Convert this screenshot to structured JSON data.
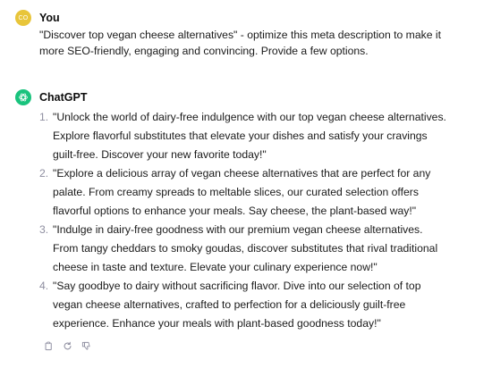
{
  "user_message": {
    "avatar_initials": "CO",
    "author": "You",
    "text": "\"Discover top vegan cheese alternatives\" - optimize this meta description to make it more SEO-friendly, engaging and convincing. Provide a few options."
  },
  "assistant_message": {
    "author": "ChatGPT",
    "avatar_icon": "openai-logo-icon",
    "options": [
      {
        "num": "1.",
        "text": "\"Unlock the world of dairy-free indulgence with our top vegan cheese alternatives. Explore flavorful substitutes that elevate your dishes and satisfy your cravings guilt-free. Discover your new favorite today!\""
      },
      {
        "num": "2.",
        "text": "\"Explore a delicious array of vegan cheese alternatives that are perfect for any palate. From creamy spreads to meltable slices, our curated selection offers flavorful options to enhance your meals. Say cheese, the plant-based way!\""
      },
      {
        "num": "3.",
        "text": "\"Indulge in dairy-free goodness with our premium vegan cheese alternatives. From tangy cheddars to smoky goudas, discover substitutes that rival traditional cheese in taste and texture. Elevate your culinary experience now!\""
      },
      {
        "num": "4.",
        "text": "\"Say goodbye to dairy without sacrificing flavor. Dive into our selection of top vegan cheese alternatives, crafted to perfection for a deliciously guilt-free experience. Enhance your meals with plant-based goodness today!\""
      }
    ],
    "actions": [
      "copy-icon",
      "regenerate-icon",
      "thumbs-down-icon"
    ]
  },
  "colors": {
    "user_avatar": "#e8c53a",
    "assistant_avatar": "#19c37d",
    "list_number": "#8e8ea0",
    "action_icon": "#8e8ea0"
  }
}
